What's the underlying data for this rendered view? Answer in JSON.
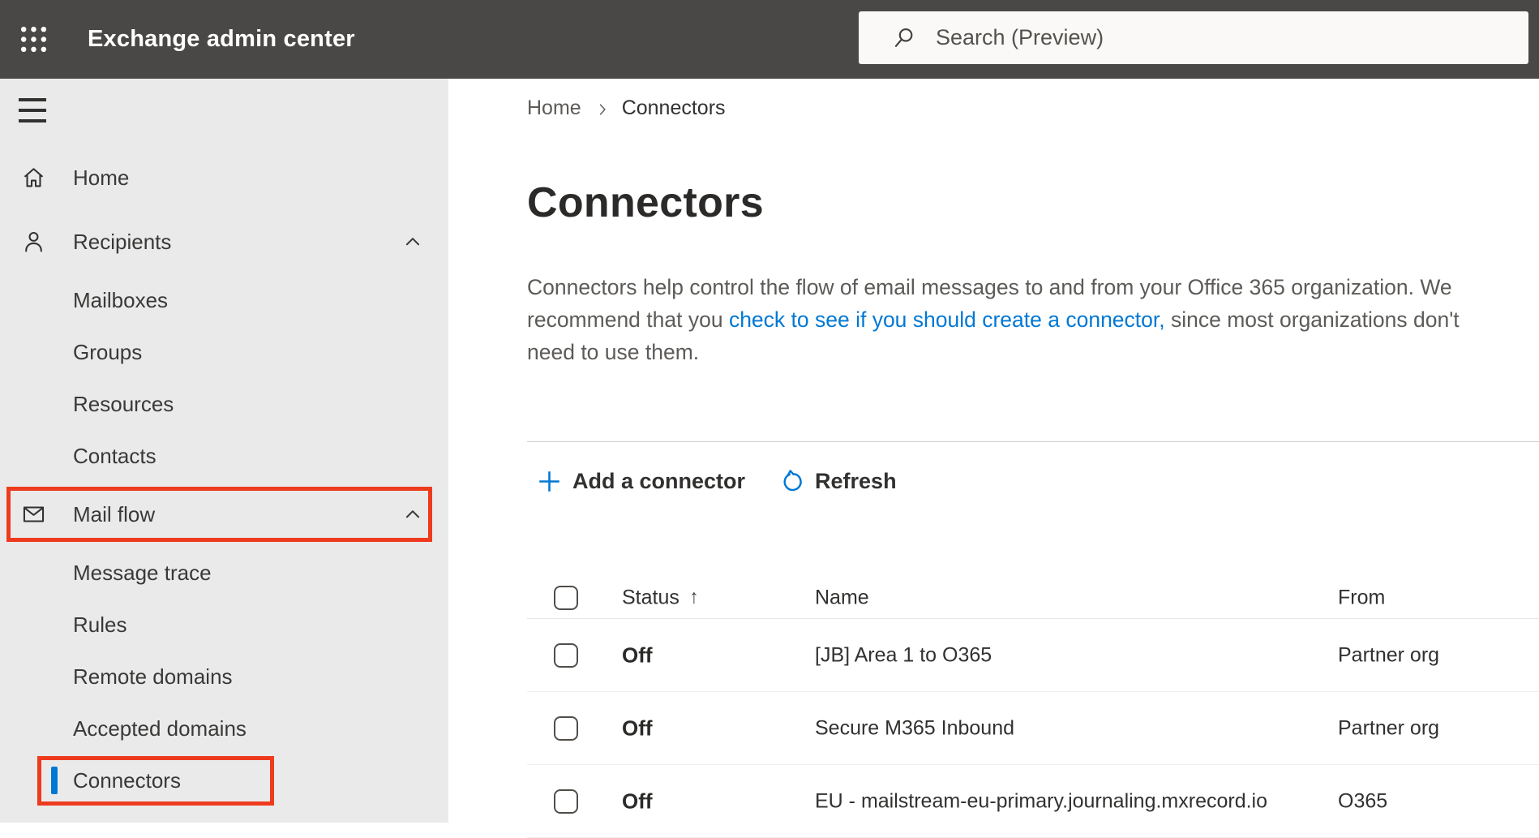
{
  "colors": {
    "accent_blue": "#0078d4",
    "annotation_red": "#ee3b1e",
    "topbar_bg": "#4a4846",
    "sidebar_bg": "#eaeaea",
    "selected_bar_blue": "#0078d4"
  },
  "topbar": {
    "title": "Exchange admin center",
    "search_placeholder": "Search (Preview)"
  },
  "sidebar": {
    "items": [
      {
        "label": "Home"
      },
      {
        "label": "Recipients"
      },
      {
        "label": "Mailboxes"
      },
      {
        "label": "Groups"
      },
      {
        "label": "Resources"
      },
      {
        "label": "Contacts"
      },
      {
        "label": "Mail flow"
      },
      {
        "label": "Message trace"
      },
      {
        "label": "Rules"
      },
      {
        "label": "Remote domains"
      },
      {
        "label": "Accepted domains"
      },
      {
        "label": "Connectors"
      }
    ]
  },
  "breadcrumb": {
    "home": "Home",
    "current": "Connectors"
  },
  "page": {
    "title": "Connectors"
  },
  "description": {
    "line1": "Connectors help control the flow of email messages to and from your Office 365 organization. We",
    "line2_pre": "recommend that you ",
    "line2_link": "check to see if you should create a connector,",
    "line2_post": " since most organizations don't",
    "line3": "need to use them."
  },
  "toolbar": {
    "add_label": "Add a connector",
    "refresh_label": "Refresh"
  },
  "table": {
    "headers": {
      "status": "Status",
      "name": "Name",
      "from": "From"
    },
    "sort_icon": "↑",
    "rows": [
      {
        "status": "Off",
        "name": "[JB] Area 1 to O365",
        "from": "Partner org"
      },
      {
        "status": "Off",
        "name": "Secure M365 Inbound",
        "from": "Partner org"
      },
      {
        "status": "Off",
        "name": "EU - mailstream-eu-primary.journaling.mxrecord.io",
        "from": "O365"
      }
    ]
  }
}
